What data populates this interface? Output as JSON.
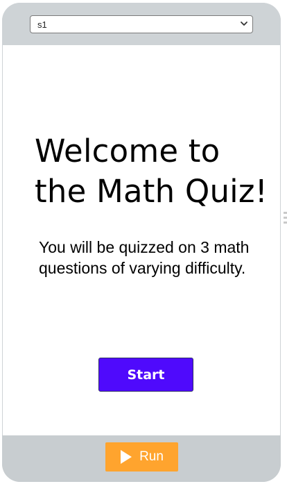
{
  "screen_selector": {
    "selected": "s1",
    "options": [
      "s1"
    ]
  },
  "screen": {
    "title": "Welcome to the Math Quiz!",
    "intro": "You will be quizzed on 3 math questions of varying difficulty.",
    "start_label": "Start"
  },
  "footer": {
    "run_label": "Run"
  },
  "icons": {
    "dropdown": "chevron-down-icon",
    "run": "play-icon",
    "resize": "resize-handle-icon"
  },
  "colors": {
    "frame": "#ced3d6",
    "start_button": "#4f0afc",
    "run_button": "#ffa42e",
    "screen_background": "#ffffff"
  }
}
